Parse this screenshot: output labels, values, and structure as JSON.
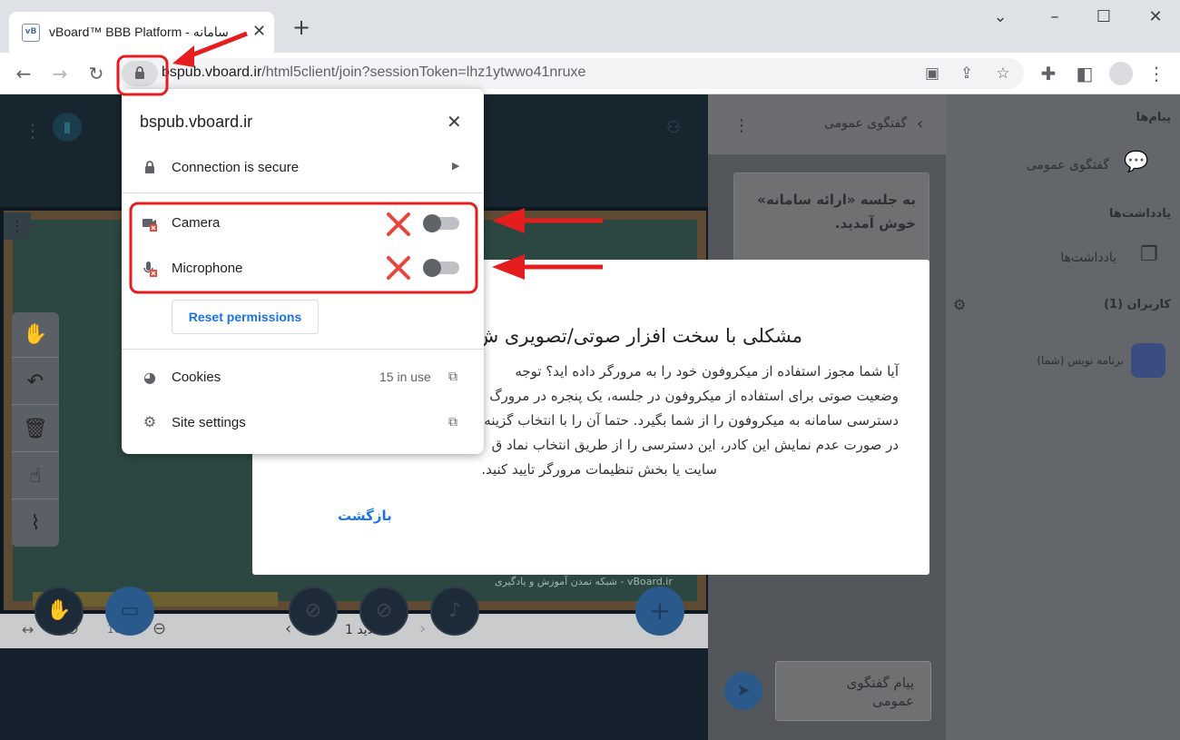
{
  "browser": {
    "tab_title": "vBoard™ BBB Platform - سامانه",
    "tab_favicon": "vB",
    "url_host": "bspub.vboard.ir",
    "url_path": "/html5client/join?sessionToken=lhz1ytwwo41nruxe"
  },
  "site_info": {
    "host": "bspub.vboard.ir",
    "connection": "Connection is secure",
    "permissions": [
      {
        "label": "Camera",
        "icon": "camera-blocked-icon",
        "enabled": false
      },
      {
        "label": "Microphone",
        "icon": "microphone-blocked-icon",
        "enabled": false
      }
    ],
    "reset_label": "Reset permissions",
    "cookies_label": "Cookies",
    "cookies_count": "15 in use",
    "site_settings_label": "Site settings"
  },
  "modal": {
    "title": "مشکلی با سخت افزار صوتی/تصویری ش",
    "lines": [
      "آیا شما مجوز استفاده از میکروفون خود را به مرورگر داده اید؟ توجه",
      "وضعیت صوتی برای استفاده از میکروفون در جلسه، یک پنجره در مرورگ",
      "دسترسی سامانه به میکروفون را از شما بگیرد. حتما آن را با انتخاب گزینه",
      "در صورت عدم نمایش این کادر، این دسترسی را از طریق انتخاب نماد ق",
      "سایت یا بخش تنظیمات مرورگر تایید کنید."
    ],
    "back_label": "بازگشت"
  },
  "chat": {
    "header": "گفتگوی عمومی",
    "welcome_line1": "به جلسه «ارائه سامانه»",
    "welcome_line2": "خوش آمدید.",
    "input_placeholder_line1": "پیام گفتگوی",
    "input_placeholder_line2": "عمومی"
  },
  "sidebar": {
    "messages_heading": "پیام‌ها",
    "public_chat": "گفتگوی عمومی",
    "notes_heading": "یادداشت‌ها",
    "notes_item": "یادداشت‌ها",
    "users_heading": "کاربران (1)",
    "user_name": "برنامه نویس (شما)"
  },
  "slide_controls": {
    "zoom": "100%",
    "slide_label": "اسلاید 1",
    "credit": "vBoard.ir - شبکه تمدن آموزش و یادگیری"
  },
  "colors": {
    "annotation_red": "#e41e1e",
    "link_blue": "#1a73e8",
    "blocked_x": "#e8453c"
  }
}
